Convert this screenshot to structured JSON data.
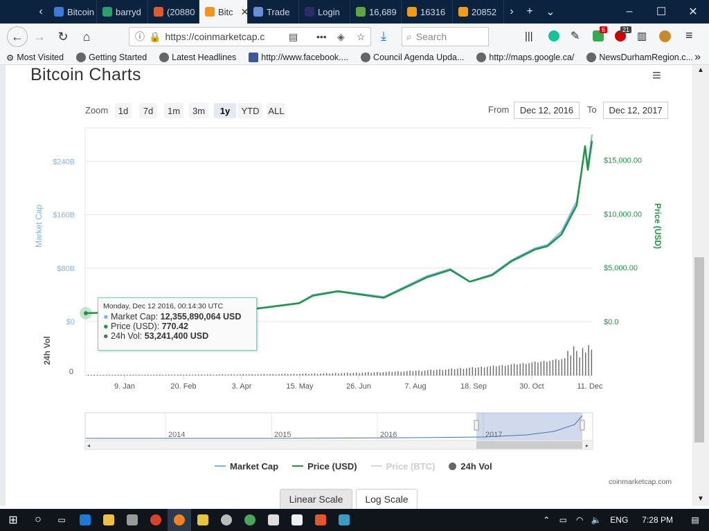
{
  "browser": {
    "tabs": [
      {
        "label": "Bitcoin",
        "color": "#3d7bd9"
      },
      {
        "label": "barryd",
        "color": "#29a06a"
      },
      {
        "label": "(20880",
        "color": "#e05a2c"
      },
      {
        "label": "Bitc",
        "color": "#f7931a",
        "active": true
      },
      {
        "label": "Trade",
        "color": "#6b8cd6"
      },
      {
        "label": "Login",
        "color": "#2b2b6b"
      },
      {
        "label": "16,689",
        "color": "#5ea83a"
      },
      {
        "label": "16316",
        "color": "#f39c12"
      },
      {
        "label": "20852",
        "color": "#f39c12"
      }
    ],
    "url": "https://coinmarketcap.c",
    "search_placeholder": "Search",
    "badge_notif": "6",
    "badge_count": "21",
    "bookmarks": [
      "Most Visited",
      "Getting Started",
      "Latest Headlines",
      "http://www.facebook....",
      "Council Agenda Upda...",
      "http://maps.google.ca/",
      "NewsDurhamRegion.c..."
    ]
  },
  "page": {
    "title": "Bitcoin Charts",
    "zoom_label": "Zoom",
    "zoom_options": [
      "1d",
      "7d",
      "1m",
      "3m",
      "1y",
      "YTD",
      "ALL"
    ],
    "zoom_selected": "1y",
    "from_label": "From",
    "from_date": "Dec 12, 2016",
    "to_label": "To",
    "to_date": "Dec 12, 2017",
    "tooltip": {
      "date": "Monday, Dec 12 2016, 00:14:30 UTC",
      "market_cap_label": "Market Cap:",
      "market_cap": "12,355,890,064 USD",
      "price_label": "Price (USD):",
      "price": "770.42",
      "vol_label": "24h Vol:",
      "vol": "53,241,400 USD"
    },
    "credit": "coinmarketcap.com",
    "linear_scale": "Linear Scale",
    "log_scale": "Log Scale"
  },
  "colors": {
    "market_cap": "#7cb5ec",
    "price": "#1d9642",
    "price_btc": "#d8d8d8",
    "volume": "#666666"
  },
  "chart_data": {
    "type": "line",
    "title": "",
    "x_ticks": [
      "9. Jan",
      "20. Feb",
      "3. Apr",
      "15. May",
      "26. Jun",
      "7. Aug",
      "18. Sep",
      "30. Oct",
      "11. Dec"
    ],
    "y_left_label": "Market Cap",
    "y_left_ticks": [
      "$0",
      "$80B",
      "$160B",
      "$240B"
    ],
    "y_left_range": [
      0,
      290
    ],
    "y_right_label": "Price (USD)",
    "y_right_ticks": [
      "$0.0",
      "$5,000.00",
      "$10,000.00",
      "$15,000.00"
    ],
    "y_right_range": [
      0,
      18000
    ],
    "vol_label": "24h Vol",
    "vol_ticks": [
      "0"
    ],
    "navigator_years": [
      "2014",
      "2015",
      "2016",
      "2017"
    ],
    "x_range": [
      "2016-12-12",
      "2017-12-12"
    ],
    "series": [
      {
        "name": "Market Cap",
        "unit": "USD billions",
        "x": [
          "2016-12-12",
          "2017-01-15",
          "2017-02-15",
          "2017-03-15",
          "2017-04-15",
          "2017-05-15",
          "2017-05-25",
          "2017-06-12",
          "2017-07-15",
          "2017-08-15",
          "2017-09-01",
          "2017-09-15",
          "2017-10-01",
          "2017-10-15",
          "2017-11-01",
          "2017-11-10",
          "2017-11-20",
          "2017-12-01",
          "2017-12-07",
          "2017-12-09",
          "2017-12-12"
        ],
        "values": [
          12.4,
          14,
          17,
          18,
          20,
          28,
          40,
          46,
          37,
          68,
          79,
          60,
          71,
          92,
          110,
          115,
          135,
          180,
          260,
          235,
          280
        ]
      },
      {
        "name": "Price (USD)",
        "x": [
          "2016-12-12",
          "2017-01-15",
          "2017-02-15",
          "2017-03-15",
          "2017-04-15",
          "2017-05-15",
          "2017-05-25",
          "2017-06-12",
          "2017-07-15",
          "2017-08-15",
          "2017-09-01",
          "2017-09-15",
          "2017-10-01",
          "2017-10-15",
          "2017-11-01",
          "2017-11-10",
          "2017-11-20",
          "2017-12-01",
          "2017-12-07",
          "2017-12-09",
          "2017-12-12"
        ],
        "values": [
          770,
          900,
          1050,
          1100,
          1200,
          1700,
          2400,
          2800,
          2200,
          4100,
          4800,
          3700,
          4300,
          5600,
          6700,
          7000,
          8100,
          10800,
          16300,
          14100,
          16800
        ]
      },
      {
        "name": "Price (BTC)",
        "values": []
      },
      {
        "name": "24h Vol",
        "values": []
      }
    ]
  }
}
